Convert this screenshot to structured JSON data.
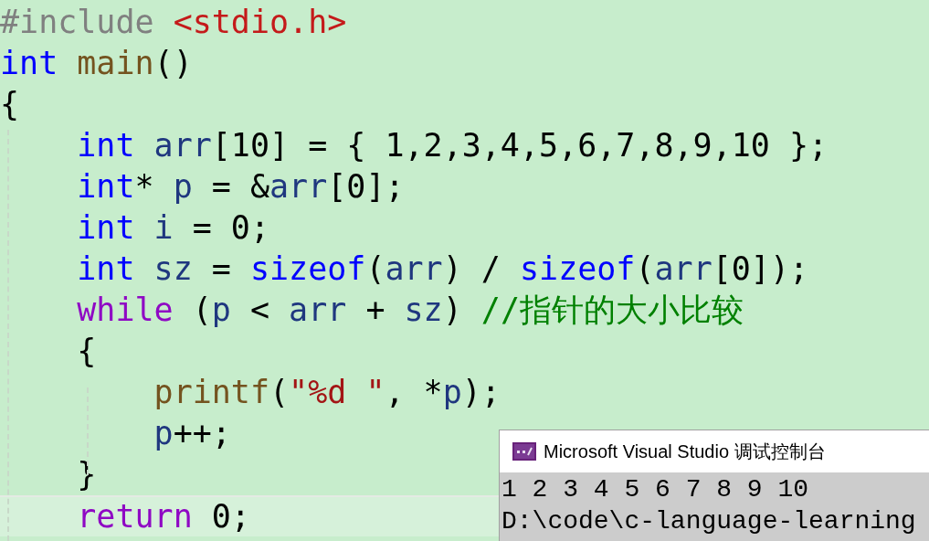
{
  "editor": {
    "lines": [
      {
        "current": false,
        "tokens": [
          {
            "kind": "preproc",
            "text": "#include "
          },
          {
            "kind": "path",
            "text": "<stdio.h>"
          }
        ]
      },
      {
        "current": false,
        "tokens": [
          {
            "kind": "keyword",
            "text": "int "
          },
          {
            "kind": "function",
            "text": "main"
          },
          {
            "kind": "plain",
            "text": "()"
          }
        ]
      },
      {
        "current": false,
        "tokens": [
          {
            "kind": "plain",
            "text": "{"
          }
        ]
      },
      {
        "current": false,
        "tokens": [
          {
            "kind": "keyword",
            "text": "    int "
          },
          {
            "kind": "variable",
            "text": "arr"
          },
          {
            "kind": "plain",
            "text": "[10] = { 1,2,3,4,5,6,7,8,9,10 };"
          }
        ]
      },
      {
        "current": false,
        "tokens": [
          {
            "kind": "keyword",
            "text": "    int"
          },
          {
            "kind": "plain",
            "text": "* "
          },
          {
            "kind": "variable",
            "text": "p"
          },
          {
            "kind": "plain",
            "text": " = &"
          },
          {
            "kind": "variable",
            "text": "arr"
          },
          {
            "kind": "plain",
            "text": "[0];"
          }
        ]
      },
      {
        "current": false,
        "tokens": [
          {
            "kind": "keyword",
            "text": "    int "
          },
          {
            "kind": "variable",
            "text": "i"
          },
          {
            "kind": "plain",
            "text": " = 0;"
          }
        ]
      },
      {
        "current": false,
        "tokens": [
          {
            "kind": "keyword",
            "text": "    int "
          },
          {
            "kind": "variable",
            "text": "sz"
          },
          {
            "kind": "plain",
            "text": " = "
          },
          {
            "kind": "keyword",
            "text": "sizeof"
          },
          {
            "kind": "plain",
            "text": "("
          },
          {
            "kind": "variable",
            "text": "arr"
          },
          {
            "kind": "plain",
            "text": ") / "
          },
          {
            "kind": "keyword",
            "text": "sizeof"
          },
          {
            "kind": "plain",
            "text": "("
          },
          {
            "kind": "variable",
            "text": "arr"
          },
          {
            "kind": "plain",
            "text": "[0]);"
          }
        ]
      },
      {
        "current": false,
        "tokens": [
          {
            "kind": "control",
            "text": "    while"
          },
          {
            "kind": "plain",
            "text": " ("
          },
          {
            "kind": "variable",
            "text": "p"
          },
          {
            "kind": "plain",
            "text": " < "
          },
          {
            "kind": "variable",
            "text": "arr"
          },
          {
            "kind": "plain",
            "text": " + "
          },
          {
            "kind": "variable",
            "text": "sz"
          },
          {
            "kind": "plain",
            "text": ") "
          },
          {
            "kind": "comment",
            "text": "//指针的大小比较"
          }
        ]
      },
      {
        "current": false,
        "tokens": [
          {
            "kind": "plain",
            "text": "    {"
          }
        ]
      },
      {
        "current": false,
        "tokens": [
          {
            "kind": "function",
            "text": "        printf"
          },
          {
            "kind": "plain",
            "text": "("
          },
          {
            "kind": "string",
            "text": "\"%d \""
          },
          {
            "kind": "plain",
            "text": ", *"
          },
          {
            "kind": "variable",
            "text": "p"
          },
          {
            "kind": "plain",
            "text": ");"
          }
        ]
      },
      {
        "current": false,
        "tokens": [
          {
            "kind": "variable",
            "text": "        p"
          },
          {
            "kind": "plain",
            "text": "++;"
          }
        ]
      },
      {
        "current": false,
        "tokens": [
          {
            "kind": "plain",
            "text": "    }"
          }
        ]
      },
      {
        "current": true,
        "tokens": [
          {
            "kind": "control",
            "text": "    return"
          },
          {
            "kind": "plain",
            "text": " 0;"
          }
        ]
      }
    ]
  },
  "console": {
    "title": "Microsoft Visual Studio 调试控制台",
    "lines": [
      "1 2 3 4 5 6 7 8 9 10",
      "D:\\code\\c-language-learning"
    ]
  }
}
